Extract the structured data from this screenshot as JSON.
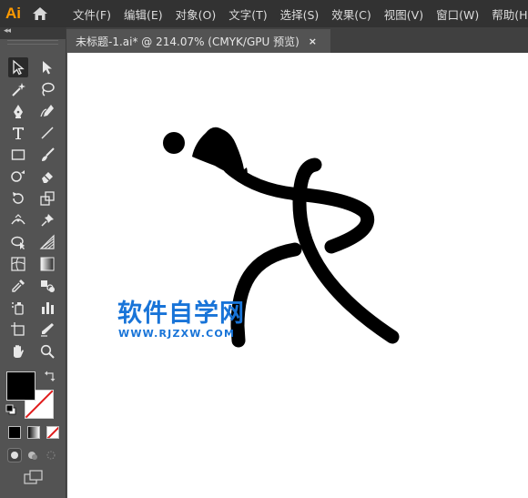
{
  "app": {
    "logo_text": "Ai"
  },
  "menu": [
    "文件(F)",
    "编辑(E)",
    "对象(O)",
    "文字(T)",
    "选择(S)",
    "效果(C)",
    "视图(V)",
    "窗口(W)",
    "帮助(H)"
  ],
  "document_tab": {
    "title": "未标题-1.ai* @ 214.07% (CMYK/GPU 预览)",
    "close": "×"
  },
  "toolpanel": {
    "collapse": "◂◂"
  },
  "tools": [
    "selection-tool",
    "direct-selection-tool",
    "magic-wand-tool",
    "lasso-tool",
    "pen-tool",
    "curvature-tool",
    "type-tool",
    "line-segment-tool",
    "rectangle-tool",
    "paintbrush-tool",
    "shaper-tool",
    "eraser-tool",
    "rotate-tool",
    "scale-tool",
    "width-tool",
    "puppet-warp-tool",
    "shape-builder-tool",
    "perspective-grid-tool",
    "mesh-tool",
    "gradient-tool",
    "eyedropper-tool",
    "blend-tool",
    "symbol-sprayer-tool",
    "column-graph-tool",
    "artboard-tool",
    "slice-tool",
    "hand-tool",
    "zoom-tool"
  ],
  "colors": {
    "fill": "#000000",
    "stroke": "none",
    "accent_logo": "#ff9a00",
    "watermark": "#1874d8"
  },
  "watermark": {
    "title": "软件自学网",
    "url": "WWW.RJZXW.COM"
  }
}
